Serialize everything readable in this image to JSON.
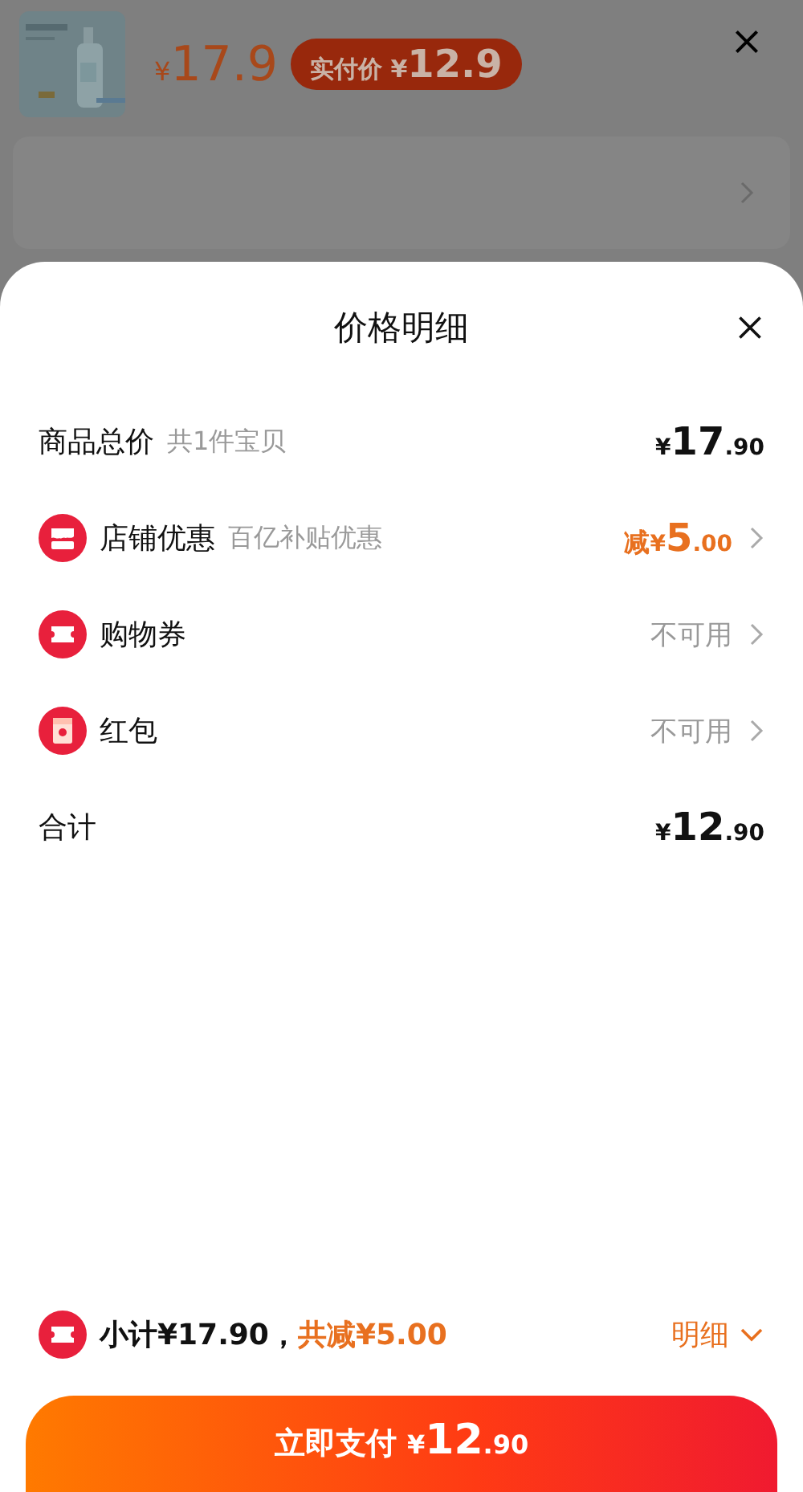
{
  "backdrop": {
    "price": {
      "currency": "¥",
      "amount": "17.9"
    },
    "badge": {
      "label": "实付价",
      "currency": "¥",
      "amount": "12.9"
    }
  },
  "sheet": {
    "title": "价格明细",
    "rows": [
      {
        "kind": "plain",
        "label": "商品总价",
        "note": "共1件宝贝",
        "value": {
          "currency": "¥",
          "integer": "17",
          "decimal": ".90"
        },
        "highlight": false,
        "has_arrow": false
      },
      {
        "kind": "store",
        "label": "店铺优惠",
        "note": "百亿补贴优惠",
        "value": {
          "prefix": "减",
          "currency": "¥",
          "integer": "5",
          "decimal": ".00"
        },
        "highlight": true,
        "has_arrow": true
      },
      {
        "kind": "coupon",
        "label": "购物券",
        "status": "不可用",
        "has_arrow": true
      },
      {
        "kind": "red-packet",
        "label": "红包",
        "status": "不可用",
        "has_arrow": true
      },
      {
        "kind": "plain",
        "label": "合计",
        "value": {
          "currency": "¥",
          "integer": "12",
          "decimal": ".90"
        },
        "highlight": false,
        "has_arrow": false
      }
    ]
  },
  "footer": {
    "subtotal": "小计¥17.90，",
    "savings": "共减¥5.00",
    "details_toggle": "明细"
  },
  "pay_button": {
    "label": "立即支付",
    "currency": "¥",
    "integer": "12",
    "decimal": ".90"
  }
}
